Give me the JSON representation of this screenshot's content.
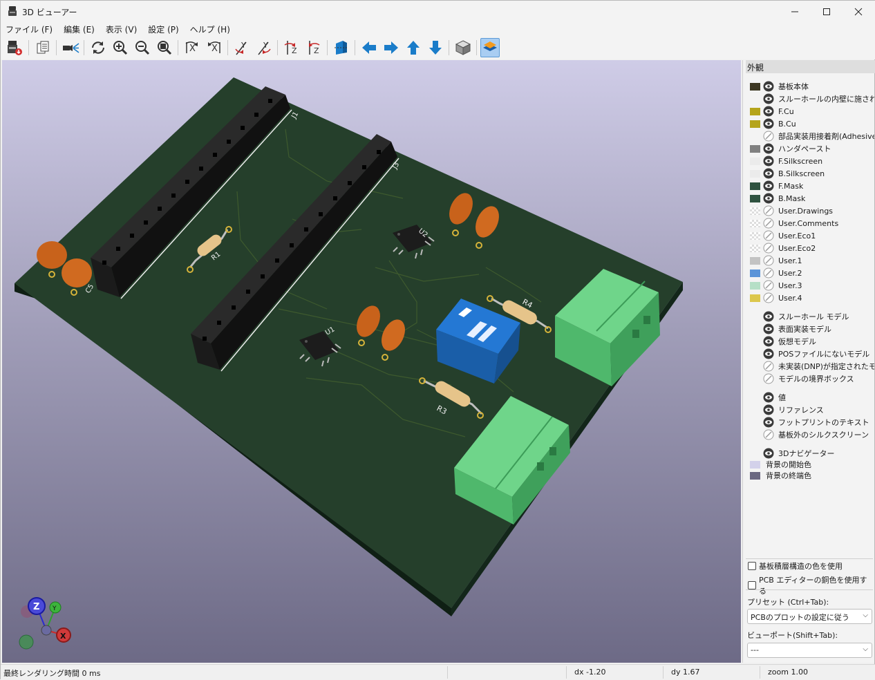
{
  "window": {
    "title": "3D ビューアー"
  },
  "menu": [
    "ファイル (F)",
    "編集 (E)",
    "表示 (V)",
    "設定 (P)",
    "ヘルプ (H)"
  ],
  "toolbar": {
    "icons": [
      "export-image-icon",
      "copy-icon",
      "raytrace-icon",
      "reload-icon",
      "zoom-in-icon",
      "zoom-out-icon",
      "zoom-fit-icon",
      "rotate-x-cw-icon",
      "rotate-x-ccw-icon",
      "rotate-y-cw-icon",
      "rotate-y-ccw-icon",
      "rotate-z-cw-icon",
      "rotate-z-ccw-icon",
      "flip-board-icon",
      "move-left-icon",
      "move-right-icon",
      "move-up-icon",
      "move-down-icon",
      "orthographic-icon",
      "layers-manager-icon"
    ]
  },
  "board": {
    "labels": {
      "j1": "J1",
      "j3": "J3",
      "r1": "R1",
      "r3": "R3",
      "r4": "R4",
      "u1": "U1",
      "u2": "U2",
      "c5": "C5"
    },
    "axes": {
      "z": "Z",
      "y": "Y",
      "x": "X"
    }
  },
  "appearance": {
    "title": "外観",
    "layers": [
      {
        "label": "基板本体",
        "color": "#3c3722",
        "visible": true
      },
      {
        "label": "スルーホールの内壁に施されたメ",
        "color": "",
        "visible": true
      },
      {
        "label": "F.Cu",
        "color": "#b5a41b",
        "visible": true
      },
      {
        "label": "B.Cu",
        "color": "#b5a41b",
        "visible": true
      },
      {
        "label": "部品実装用接着剤(Adhesive",
        "color": "",
        "visible": false
      },
      {
        "label": "ハンダペースト",
        "color": "#808080",
        "visible": true
      },
      {
        "label": "F.Silkscreen",
        "color": "#ebebeb",
        "visible": true
      },
      {
        "label": "B.Silkscreen",
        "color": "#ebebeb",
        "visible": true
      },
      {
        "label": "F.Mask",
        "color": "#2f5240",
        "visible": true
      },
      {
        "label": "B.Mask",
        "color": "#2f5240",
        "visible": true
      },
      {
        "label": "User.Drawings",
        "color": "checker",
        "visible": false
      },
      {
        "label": "User.Comments",
        "color": "checker",
        "visible": false
      },
      {
        "label": "User.Eco1",
        "color": "checker",
        "visible": false
      },
      {
        "label": "User.Eco2",
        "color": "checker",
        "visible": false
      },
      {
        "label": "User.1",
        "color": "#c3c3c3",
        "visible": false
      },
      {
        "label": "User.2",
        "color": "#5b94d8",
        "visible": false
      },
      {
        "label": "User.3",
        "color": "#b5dfc6",
        "visible": false
      },
      {
        "label": "User.4",
        "color": "#dcc74c",
        "visible": false
      }
    ],
    "models": [
      {
        "label": "スルーホール モデル",
        "visible": true
      },
      {
        "label": "表面実装モデル",
        "visible": true
      },
      {
        "label": "仮想モデル",
        "visible": true
      },
      {
        "label": "POSファイルにないモデル",
        "visible": true
      },
      {
        "label": "未実装(DNP)が指定されたモデ",
        "visible": false
      },
      {
        "label": "モデルの境界ボックス",
        "visible": false
      }
    ],
    "misc": [
      {
        "label": "値",
        "visible": true
      },
      {
        "label": "リファレンス",
        "visible": true
      },
      {
        "label": "フットプリントのテキスト",
        "visible": true
      },
      {
        "label": "基板外のシルクスクリーン",
        "visible": false
      }
    ],
    "nav": [
      {
        "label": "3Dナビゲーター",
        "color": "",
        "visible": true
      },
      {
        "label": "背景の開始色",
        "color": "#d3d1ea",
        "visible": null
      },
      {
        "label": "背景の終端色",
        "color": "#6b6882",
        "visible": null
      }
    ],
    "checkboxes": [
      "基板積層構造の色を使用",
      "PCB エディターの銅色を使用する"
    ],
    "preset_label": "プリセット (Ctrl+Tab):",
    "preset_value": "PCBのプロットの設定に従う",
    "viewport_label": "ビューポート(Shift+Tab):",
    "viewport_value": "---"
  },
  "status": {
    "render_time": "最終レンダリング時間 0 ms",
    "dx": "dx -1.20",
    "dy": "dy 1.67",
    "zoom": "zoom 1.00"
  }
}
